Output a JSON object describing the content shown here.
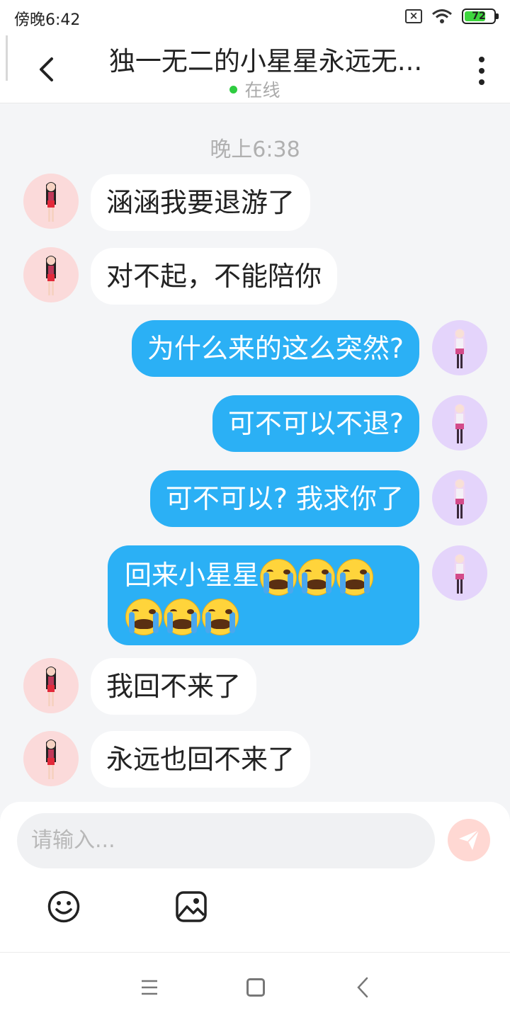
{
  "status_bar": {
    "time": "傍晚6:42",
    "battery": "72",
    "battery_level": 0.72
  },
  "header": {
    "title": "独一无二的小星星永远无...",
    "presence": "在线"
  },
  "conversation": {
    "timestamp": "晚上6:38",
    "messages": [
      {
        "side": "in",
        "text": "涵涵我要退游了"
      },
      {
        "side": "in",
        "text": "对不起，不能陪你"
      },
      {
        "side": "out",
        "text": "为什么来的这么突然?"
      },
      {
        "side": "out",
        "text": "可不可以不退?"
      },
      {
        "side": "out",
        "text": "可不可以? 我求你了"
      },
      {
        "side": "out",
        "text": "回来小星星",
        "emoji": [
          "loudly-crying-face",
          "loudly-crying-face",
          "loudly-crying-face",
          "loudly-crying-face",
          "loudly-crying-face",
          "loudly-crying-face"
        ]
      },
      {
        "side": "in",
        "text": "我回不来了"
      },
      {
        "side": "in",
        "text": "永远也回不来了"
      }
    ]
  },
  "composer": {
    "placeholder": "请输入..."
  },
  "icons": {
    "back": "chevron-left-icon",
    "more": "more-vertical-icon",
    "send": "send-icon",
    "emoji": "smiley-icon",
    "image": "image-icon"
  },
  "colors": {
    "outgoing_bubble": "#2bb0f5",
    "incoming_bubble": "#ffffff",
    "online_dot": "#2ecc40",
    "battery_fill": "#3ed63e",
    "send_button": "#ffd8d3"
  }
}
